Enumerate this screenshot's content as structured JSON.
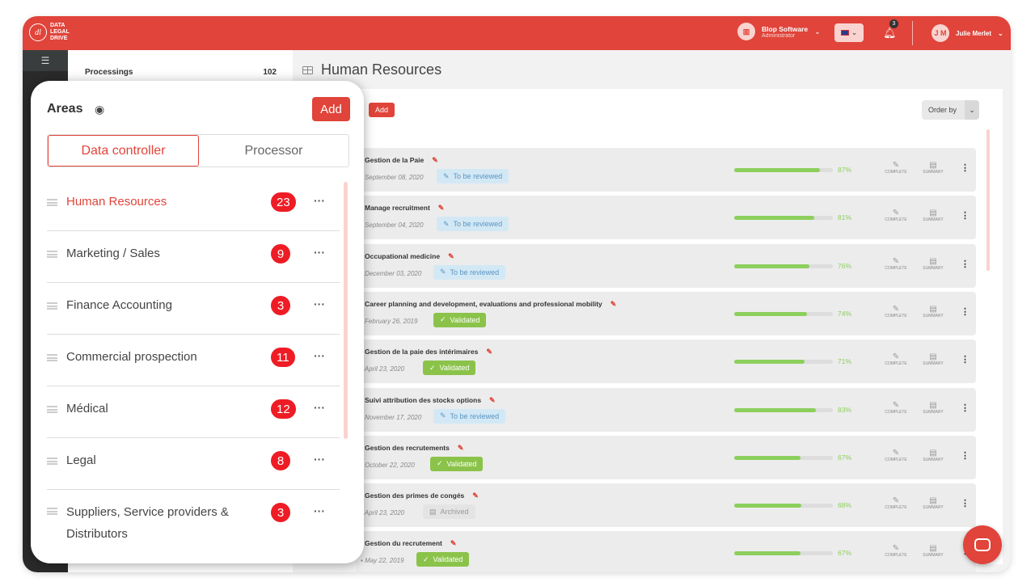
{
  "header": {
    "logo_text": "DATA LEGAL DRIVE",
    "org_name": "Blop Software",
    "org_role": "Administrator",
    "notifications": "3",
    "user_initials": "J M",
    "user_name": "Julie Merlet"
  },
  "subpanel": {
    "label": "Processings",
    "count": "102"
  },
  "main": {
    "title": "Human Resources",
    "add_label": "Add",
    "order_label": "Order by",
    "complete_label": "COMPLETE",
    "summary_label": "SUMMARY",
    "rows": [
      {
        "title": "Gestion de la Paie",
        "date": "September 08, 2020",
        "status": "To be reviewed",
        "progress": 87
      },
      {
        "title": "Manage recruitment",
        "date": "September 04, 2020",
        "status": "To be reviewed",
        "progress": 81
      },
      {
        "title": "Occupational medicine",
        "date": "December 03, 2020",
        "status": "To be reviewed",
        "progress": 76
      },
      {
        "title": "Career planning and development, evaluations and professional mobility",
        "date": "February 26, 2019",
        "status": "Validated",
        "progress": 74
      },
      {
        "title": "Gestion de la paie des intérimaires",
        "date": "April 23, 2020",
        "status": "Validated",
        "progress": 71
      },
      {
        "title": "Suivi attribution des stocks options",
        "date": "November 17, 2020",
        "status": "To be reviewed",
        "progress": 83
      },
      {
        "title": "Gestion des recrutements",
        "date": "October 22, 2020",
        "status": "Validated",
        "progress": 67
      },
      {
        "title": "Gestion des primes de congés",
        "date": "April 23, 2020",
        "status": "Archived",
        "progress": 68
      },
      {
        "title": "Gestion du recrutement",
        "date": "May 22, 2019",
        "status": "Validated",
        "progress": 67
      }
    ]
  },
  "areas": {
    "title": "Areas",
    "add_label": "Add",
    "tabs": [
      "Data controller",
      "Processor"
    ],
    "active_tab": 0,
    "items": [
      {
        "name": "Human Resources",
        "count": "23",
        "active": true
      },
      {
        "name": "Marketing / Sales",
        "count": "9"
      },
      {
        "name": "Finance Accounting",
        "count": "3"
      },
      {
        "name": "Commercial prospection",
        "count": "11"
      },
      {
        "name": "Médical",
        "count": "12"
      },
      {
        "name": "Legal",
        "count": "8"
      },
      {
        "name": "Suppliers, Service providers & Distributors",
        "count": "3"
      }
    ]
  },
  "colors": {
    "brand": "#e0443a",
    "progress": "#8ccf5c",
    "validated": "#8bc34a",
    "review": "#d3e8f5"
  }
}
